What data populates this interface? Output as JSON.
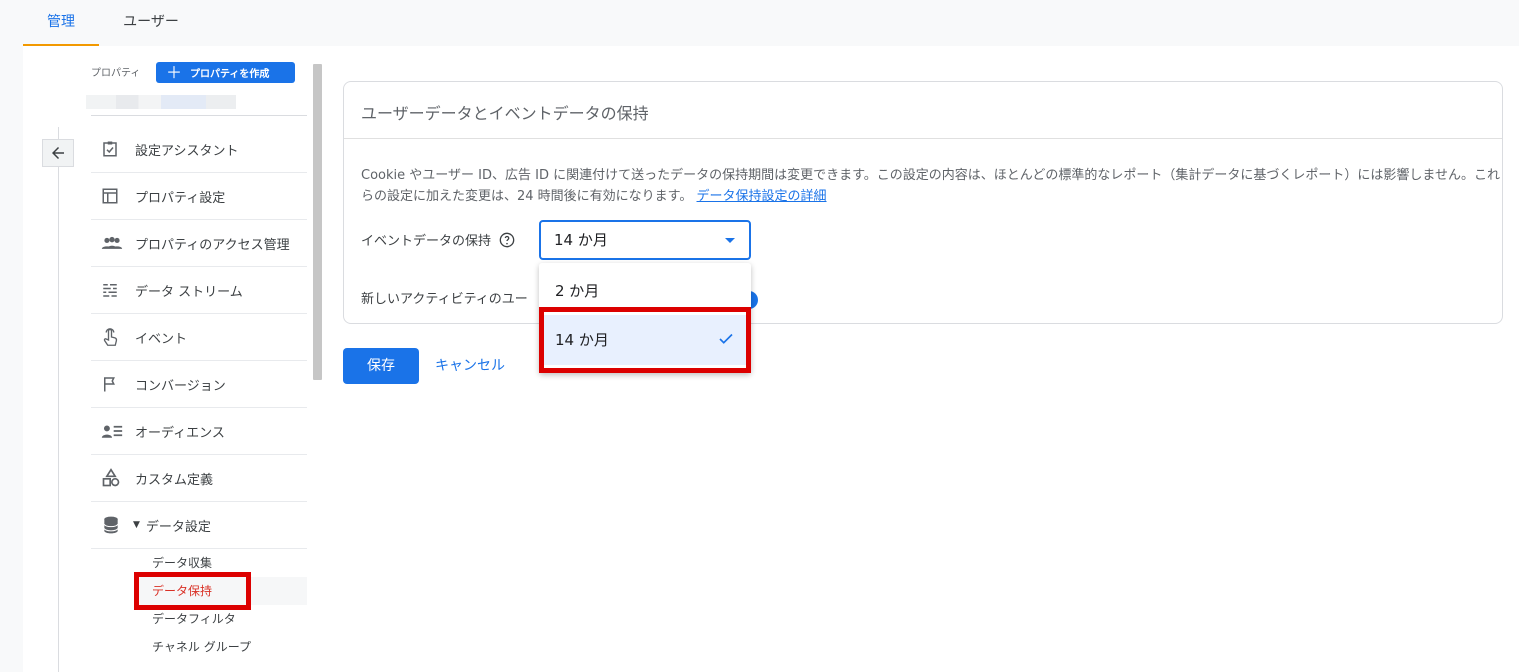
{
  "tabs": [
    {
      "label": "管理",
      "active": true
    },
    {
      "label": "ユーザー",
      "active": false
    }
  ],
  "sidebar": {
    "property_label": "プロパティ",
    "create_property_label": "プロパティを作成",
    "items": [
      {
        "label": "設定アシスタント",
        "icon": "checklist-icon"
      },
      {
        "label": "プロパティ設定",
        "icon": "layout-icon"
      },
      {
        "label": "プロパティのアクセス管理",
        "icon": "people-icon"
      },
      {
        "label": "データ ストリーム",
        "icon": "streams-icon"
      },
      {
        "label": "イベント",
        "icon": "touch-icon"
      },
      {
        "label": "コンバージョン",
        "icon": "flag-icon"
      },
      {
        "label": "オーディエンス",
        "icon": "audience-icon"
      },
      {
        "label": "カスタム定義",
        "icon": "shapes-icon"
      },
      {
        "label": "データ設定",
        "icon": "database-icon",
        "expanded": true
      }
    ],
    "sub_items": [
      {
        "label": "データ収集",
        "active": false
      },
      {
        "label": "データ保持",
        "active": true
      },
      {
        "label": "データフィルタ",
        "active": false
      },
      {
        "label": "チャネル グループ",
        "active": false
      }
    ]
  },
  "card": {
    "title": "ユーザーデータとイベントデータの保持",
    "description": "Cookie やユーザー ID、広告 ID に関連付けて送ったデータの保持期間は変更できます。この設定の内容は、ほとんどの標準的なレポート（集計データに基づくレポート）には影響しません。これらの設定に加えた変更は、24 時間後に有効になります。",
    "link_label": "データ保持設定の詳細",
    "event_retention_label": "イベントデータの保持",
    "new_activity_label": "新しいアクティビティのユー",
    "selected_value": "14 か月",
    "options": [
      "2 か月",
      "14 か月"
    ],
    "selected_index": 1
  },
  "actions": {
    "save_label": "保存",
    "cancel_label": "キャンセル"
  },
  "colors": {
    "accent": "#1a73e8",
    "tab_indicator": "#f29900",
    "highlight_box": "#dc0000",
    "active_sub_item": "#d93025"
  }
}
